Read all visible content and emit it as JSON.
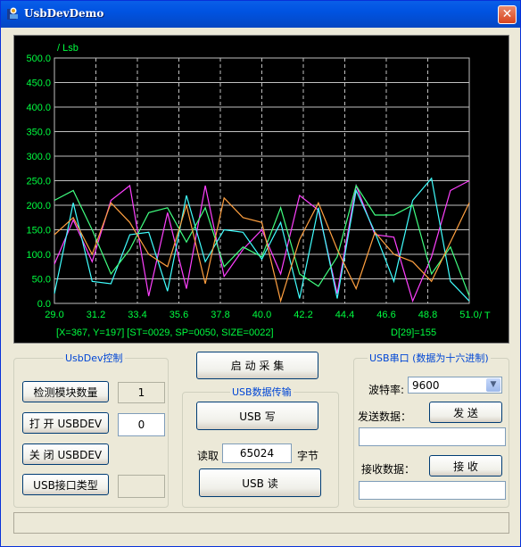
{
  "window": {
    "title": "UsbDevDemo",
    "close_glyph": "✕"
  },
  "chart_data": {
    "type": "line",
    "ylabel": "/ Lsb",
    "xlabel": "/ T",
    "ylim": [
      0,
      500
    ],
    "xlim": [
      29.0,
      51.0
    ],
    "y_ticks": [
      "0.0",
      "50.0",
      "100.0",
      "150.0",
      "200.0",
      "250.0",
      "300.0",
      "350.0",
      "400.0",
      "450.0",
      "500.0"
    ],
    "x_ticks": [
      "29.0",
      "31.2",
      "33.4",
      "35.6",
      "37.8",
      "40.0",
      "42.2",
      "44.4",
      "46.6",
      "48.8",
      "51.0"
    ],
    "x": [
      29,
      30,
      31,
      32,
      33,
      34,
      35,
      36,
      37,
      38,
      39,
      40,
      41,
      42,
      43,
      44,
      45,
      46,
      47,
      48,
      49,
      50,
      51
    ],
    "series": [
      {
        "color": "#FF40FF",
        "values": [
          80,
          170,
          85,
          210,
          240,
          15,
          185,
          30,
          240,
          55,
          110,
          150,
          60,
          220,
          190,
          20,
          240,
          140,
          135,
          5,
          95,
          230,
          250
        ]
      },
      {
        "color": "#40FFFF",
        "values": [
          20,
          205,
          45,
          40,
          140,
          145,
          25,
          220,
          85,
          150,
          145,
          90,
          165,
          10,
          195,
          10,
          230,
          145,
          45,
          210,
          255,
          45,
          5
        ]
      },
      {
        "color": "#40FF80",
        "values": [
          210,
          230,
          150,
          60,
          110,
          185,
          195,
          125,
          195,
          75,
          115,
          95,
          195,
          60,
          35,
          95,
          240,
          180,
          180,
          200,
          60,
          115,
          15
        ]
      },
      {
        "color": "#FFA040",
        "values": [
          140,
          175,
          100,
          205,
          165,
          100,
          75,
          200,
          40,
          215,
          175,
          165,
          5,
          130,
          205,
          110,
          30,
          145,
          100,
          85,
          45,
          125,
          205
        ]
      }
    ],
    "status_left": "[X=367, Y=197] [ST=0029, SP=0050, SIZE=0022]",
    "status_right": "D[29]=155"
  },
  "usbdev": {
    "group_label": "UsbDev控制",
    "detect_button": "检测模块数量",
    "detect_value": "1",
    "open_button": "打 开 USBDEV",
    "open_value": "0",
    "close_button": "关 闭 USBDEV",
    "iface_button": "USB接口类型",
    "iface_value": ""
  },
  "start_button": "启 动 采 集",
  "transfer": {
    "group_label": "USB数据传输",
    "write_button": "USB 写",
    "read_label": "读取",
    "read_value": "65024",
    "bytes_label": "字节",
    "read_button": "USB 读"
  },
  "serial": {
    "group_label": "USB串口 (数据为十六进制)",
    "baud_label": "波特率:",
    "baud_value": "9600",
    "send_label": "发送数据：",
    "send_button": "发 送",
    "send_value": "",
    "recv_label": "接收数据：",
    "recv_button": "接 收",
    "recv_value": ""
  }
}
